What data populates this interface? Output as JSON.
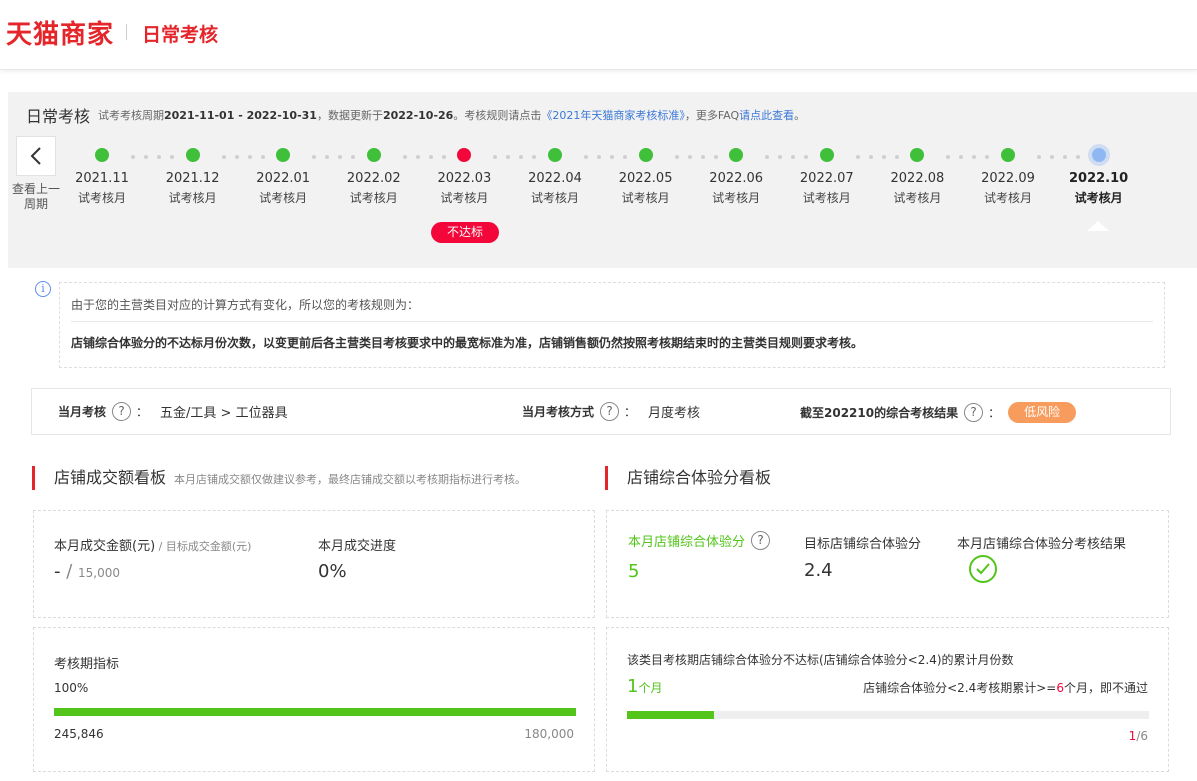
{
  "header": {
    "logo": "天猫商家",
    "subtitle": "日常考核"
  },
  "panel": {
    "title": "日常考核",
    "desc_prefix": "试考考核周期",
    "period": "2021-11-01 - 2022-10-31",
    "desc_mid": "，数据更新于",
    "updated": "2022-10-26",
    "desc_mid2": "。考核规则请点击",
    "rule_link": "《2021年天猫商家考核标准》",
    "desc_mid3": "，更多FAQ",
    "faq_link": "请点此查看",
    "desc_end": "。",
    "prev_label": "查看上一周期",
    "months": [
      {
        "name": "2021.11",
        "type": "试考核月",
        "status": "pass"
      },
      {
        "name": "2021.12",
        "type": "试考核月",
        "status": "pass"
      },
      {
        "name": "2022.01",
        "type": "试考核月",
        "status": "pass"
      },
      {
        "name": "2022.02",
        "type": "试考核月",
        "status": "pass"
      },
      {
        "name": "2022.03",
        "type": "试考核月",
        "status": "fail"
      },
      {
        "name": "2022.04",
        "type": "试考核月",
        "status": "pass"
      },
      {
        "name": "2022.05",
        "type": "试考核月",
        "status": "pass"
      },
      {
        "name": "2022.06",
        "type": "试考核月",
        "status": "pass"
      },
      {
        "name": "2022.07",
        "type": "试考核月",
        "status": "pass"
      },
      {
        "name": "2022.08",
        "type": "试考核月",
        "status": "pass"
      },
      {
        "name": "2022.09",
        "type": "试考核月",
        "status": "pass"
      },
      {
        "name": "2022.10",
        "type": "试考核月",
        "status": "current"
      }
    ],
    "fail_badge": "不达标",
    "colors": {
      "pass": "#3fbf3a",
      "fail": "#f3073a",
      "current": "#8fb8f3"
    }
  },
  "notice": {
    "icon": "info-icon",
    "line1": "由于您的主营类目对应的计算方式有变化，所以您的考核规则为：",
    "line2": "店铺综合体验分的不达标月份次数，以变更前后各主营类目考核要求中的最宽标准为准，店铺销售额仍然按照考核期结束时的主营类目规则要求考核。"
  },
  "infobar": {
    "monthly_label": "当月考核",
    "category_path": "五金/工具 > 工位器具",
    "method_label": "当月考核方式",
    "method_value": "月度考核",
    "result_label": "截至202210的综合考核结果",
    "result_value": "低风险",
    "colon": "："
  },
  "sales": {
    "title": "店铺成交额看板",
    "note": "本月店铺成交额仅做建议参考，最终店铺成交额以考核期指标进行考核。",
    "amount_label": "本月成交金额(元)",
    "target_label": " / 目标成交金额(元)",
    "amount_value": "-",
    "slash": " / ",
    "target_value": "15,000",
    "progress_label": "本月成交进度",
    "progress_value": "0%",
    "period_label": "考核期指标",
    "period_percent": "100%",
    "period_progress": 1.0,
    "period_actual": "245,846",
    "period_target": "180,000"
  },
  "experience": {
    "title": "店铺综合体验分看板",
    "score_label": "本月店铺综合体验分",
    "score_value": "5",
    "target_label": "目标店铺综合体验分",
    "target_value": "2.4",
    "result_label": "本月店铺综合体验分考核结果",
    "result_icon": "check-circle-icon",
    "fail_count_label": "该类目考核期店铺综合体验分不达标(店铺综合体验分<2.4)的累计月份数",
    "fail_count": "1",
    "fail_unit": "个月",
    "rule_prefix": "店铺综合体验分<2.4考核期累计>=",
    "rule_num": "6",
    "rule_suffix": "个月，即不通过",
    "progress": 0.1667,
    "progress_num": "1",
    "progress_total": "/6"
  }
}
